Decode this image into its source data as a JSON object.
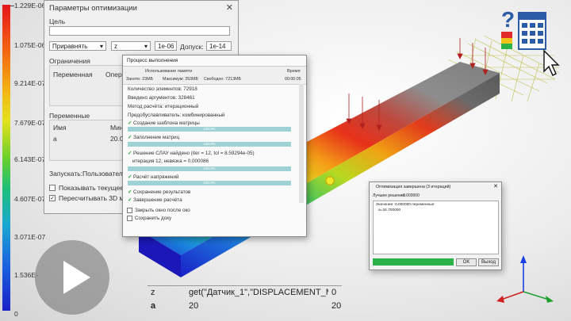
{
  "legend": {
    "labels": [
      "1.229E-06",
      "1.075E-06",
      "9.214E-07",
      "7.679E-07",
      "6.143E-07",
      "4.607E-07",
      "3.071E-07",
      "1.536E-",
      "0"
    ]
  },
  "opt_dialog": {
    "title": "Параметры оптимизации",
    "goal_label": "Цель",
    "goal_value": "",
    "mode_value": "Приравнять",
    "var_value": "z",
    "target_value": "1e-06",
    "tolerance_label": "Допуск:",
    "tolerance_value": "1e-14",
    "constraints_label": "Ограничения",
    "constraints_cols": [
      "Переменная",
      "Опер"
    ],
    "variables_label": "Переменные",
    "variables_cols": [
      "Имя",
      "Миним"
    ],
    "variables_rows": [
      [
        "a",
        "20.00"
      ]
    ],
    "run_label": "Запускать:",
    "run_value": "Пользователь",
    "check1": "Показывать текущее реше",
    "check2": "Пересчитывать 3D модель"
  },
  "progress_dialog": {
    "title": "Процесс выполнения",
    "memory_label": "Использование памяти",
    "time_label": "Время",
    "memory_busy": "Занято: 23МБ",
    "memory_max": "Максимум: 353МБ",
    "memory_free": "Свободно: 7213МБ",
    "time_value": "00:00:05",
    "lines": [
      "Количество элементов: 72918",
      "Введено аргументов: 328461",
      "Метод расчёта: итерационный",
      "Предобуславливатель: комбинированный"
    ],
    "steps": [
      {
        "text": "Создание шаблона матрицы",
        "bar": "100.0%"
      },
      {
        "text": "Заполнение матриц",
        "bar": "100.0%"
      },
      {
        "text": "Решение СЛАУ найдено (iter = 12, tol = 8.59294e-05)",
        "sub": "итерация 12,  невязка = 0.000086",
        "bar": "100.0%"
      },
      {
        "text": "Расчёт напряжений",
        "bar": "100.0%"
      },
      {
        "text": "Сохранение результатов",
        "bar": ""
      },
      {
        "text": "Завершение расчёта",
        "bar": ""
      }
    ],
    "close_after": "Закрыть окно после око",
    "save_doc": "Сохранить доку"
  },
  "done_dialog": {
    "title": "Оптимизация завершена (3 итераций)",
    "best_label": "Лучшее решение:",
    "best_value": "0.000000",
    "text_line1": "Значение: 0.000000 переменные:",
    "text_line2": "a=34.700000",
    "ok_label": "OK",
    "exit_label": "Выход",
    "progress": 1.0
  },
  "bottom_table": {
    "rows": [
      [
        "z",
        "get(\"Датчик_1\",\"DISPLACEMENT_MA",
        "0"
      ],
      [
        "a",
        "20",
        "20"
      ]
    ]
  },
  "colors": {
    "accent_green": "#2bb34a",
    "beam_red": "#e8141a",
    "beam_blue": "#1a20c8"
  }
}
